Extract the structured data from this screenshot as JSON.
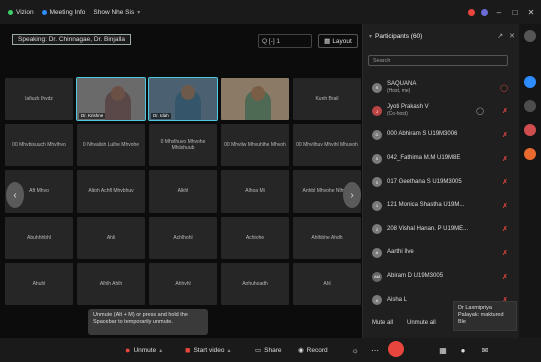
{
  "topbar": {
    "app": "Vizion",
    "meeting_info": "Meeting Info",
    "view": "Show Nhe Sis"
  },
  "viewbar": {
    "speaking": "Speaking: Dr. Chinnagae, Dr. Binjalla",
    "zoom": "Q [-] 1",
    "layout": "Layout"
  },
  "tiles": [
    {
      "name": "Iafiuzk Ihvdz",
      "type": "text"
    },
    {
      "name": "Dr. Krishne",
      "type": "video",
      "active": true
    },
    {
      "name": "Dr. Idah",
      "type": "video",
      "active": true
    },
    {
      "name": "",
      "type": "video"
    },
    {
      "name": "Kunh Brail",
      "type": "text"
    },
    {
      "name": "00 Mhvbisuuch Mhvlhvo",
      "type": "text"
    },
    {
      "name": "0 Nhvalish Lulhe Mhvohe",
      "type": "text"
    },
    {
      "name": "0 Mhvlhuvo Mhvohe Mhiishuub",
      "type": "text"
    },
    {
      "name": "00 Mhvilw Mhvuhlhe Mhvoh",
      "type": "text"
    },
    {
      "name": "00 Mhvilhuv Mhvihl Mhuvoh",
      "type": "text"
    },
    {
      "name": "Aft Mhvo",
      "type": "text"
    },
    {
      "name": "Altoh Achfl Mhvbhuv",
      "type": "text"
    },
    {
      "name": "Alkhl",
      "type": "text"
    },
    {
      "name": "Alhoa Mi",
      "type": "text"
    },
    {
      "name": "Anhbl Mhvohe Nlhvuh",
      "type": "text"
    },
    {
      "name": "Abuhhhbhl",
      "type": "text"
    },
    {
      "name": "Ahli",
      "type": "text"
    },
    {
      "name": "Achlhohl",
      "type": "text"
    },
    {
      "name": "Achtohe",
      "type": "text"
    },
    {
      "name": "Ahlhbhe Ahdh",
      "type": "text"
    },
    {
      "name": "Ahuhl",
      "type": "text"
    },
    {
      "name": "Alhlh Ahlh",
      "type": "text"
    },
    {
      "name": "Ahhvhl",
      "type": "text"
    },
    {
      "name": "Anhuhoadh",
      "type": "text"
    },
    {
      "name": "Ahl",
      "type": "text"
    }
  ],
  "unmute_tip": "Unmute (Alt + M) or press and hold the Spacebar to temporarily unmute.",
  "bottombar": {
    "unmute": "Unmute",
    "start_video": "Start video",
    "share": "Share",
    "record": "Record"
  },
  "panel": {
    "title": "Participants (60)",
    "search_placeholder": "Search",
    "participants": [
      {
        "initials": "S",
        "name": "SAQUANA",
        "sub": "(Host, me)",
        "icon": "",
        "icon2": "&#9711;"
      },
      {
        "initials": "J",
        "name": "Jyoti Prakash V",
        "sub": "(Co-host)",
        "icon": "",
        "icon2": "&#9711;"
      },
      {
        "initials": "D",
        "name": "000 Abhiram S U19M3006",
        "sub": "",
        "icon": "&#10007;",
        "icon2": ""
      },
      {
        "initials": "0",
        "name": "042_Fathima M.M U19M8E",
        "sub": "",
        "icon": "&#10007;",
        "icon2": ""
      },
      {
        "initials": "0",
        "name": "017 Geethana S U19M3005",
        "sub": "",
        "icon": "&#10007;",
        "icon2": ""
      },
      {
        "initials": "1",
        "name": "121 Monica Shastha U19M...",
        "sub": "",
        "icon": "&#10007;",
        "icon2": ""
      },
      {
        "initials": "2",
        "name": "208 Vishal Hanan. P U19ME...",
        "sub": "",
        "icon": "&#10007;",
        "icon2": ""
      },
      {
        "initials": "A",
        "name": "Aarthi Ilve",
        "sub": "",
        "icon": "&#10007;",
        "icon2": ""
      },
      {
        "initials": "AM",
        "name": "Abiram D U19M3005",
        "sub": "",
        "icon": "&#10007;",
        "icon2": ""
      },
      {
        "initials": "A",
        "name": "Aisha L",
        "sub": "",
        "icon": "&#10007;",
        "icon2": ""
      }
    ],
    "bottom": {
      "mute_all": "Mute all",
      "unmute_all": "Unmute all"
    }
  },
  "cohost_tip": "Dr Laxmipriya Palayak: maktured Ble"
}
